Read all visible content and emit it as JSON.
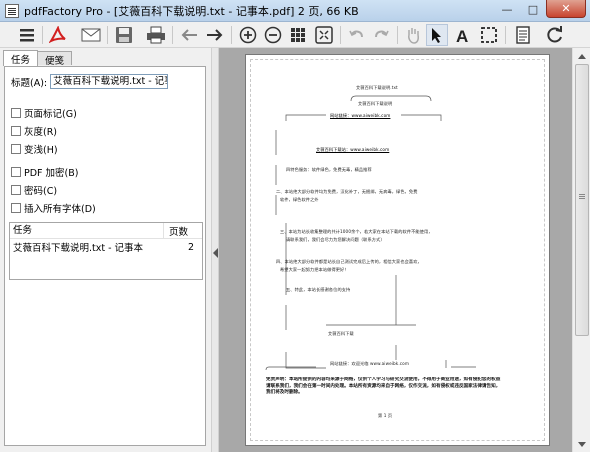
{
  "window": {
    "title": "pdfFactory Pro - [艾薇百科下载说明.txt - 记事本.pdf] 2 页, 66 KB",
    "minimize": "—",
    "maximize": "□",
    "close": "✕"
  },
  "toolbar": {
    "icons": [
      "menu-icon",
      "pdf-icon",
      "email-icon",
      "save-icon",
      "print-icon",
      "back-arrow-icon",
      "forward-arrow-icon",
      "zoom-in-icon",
      "zoom-out-icon",
      "grid-icon",
      "fit-page-icon",
      "undo-icon",
      "redo-icon",
      "hand-icon",
      "pointer-icon",
      "text-icon",
      "select-rect-icon",
      "document-icon",
      "refresh-icon"
    ]
  },
  "tabs": [
    {
      "label": "任务",
      "active": true
    },
    {
      "label": "便笺",
      "active": false
    }
  ],
  "task_panel": {
    "title_label": "标题(A):",
    "title_value": "艾薇百科下载说明.txt - 记事本",
    "checkboxes": [
      {
        "label": "页面标记(G)",
        "checked": false
      },
      {
        "label": "灰度(R)",
        "checked": false
      },
      {
        "label": "变浅(H)",
        "checked": false
      },
      {
        "label": "PDF 加密(B)",
        "checked": false
      },
      {
        "label": "密码(C)",
        "checked": false
      },
      {
        "label": "插入所有字体(D)",
        "checked": false
      }
    ],
    "table": {
      "col_task": "任务",
      "col_pages": "页数",
      "rows": [
        {
          "task": "艾薇百科下载说明.txt - 记事本",
          "pages": "2"
        }
      ]
    }
  },
  "preview": {
    "lines": [
      "艾薇百科下载说明.txt",
      "艾薇百科下载说明",
      "网站链接：www.aiweibk.com",
      "艾薇百科下载站：www.aiweibk.com",
      "四特色服务：软件绿色，免费无毒，精品推荐",
      "二、本站绝大部分软件均为免费，汉化补丁，无捆绑，无病毒，绿色，免费",
      "软件，绿色软件之外",
      "三、本站为站长收集整理的共计1000余个，若大家在本站下载的软件不能使用，",
      "请联系我们，我们会尽力为您解决问题（联系方式）",
      "四、本站绝大部分软件都是站长自己测试完成后上传的，相信大家也会喜欢，",
      "希望大家一起努力把本站做得更好！",
      "五、特此，本站长感谢各位的支持",
      "艾薇百科下载",
      "网站链接：欢迎光临 www.aiweibk.com"
    ],
    "disclaimer": "免责声明：本站所提供的内容均来源于网络，仅供个人学习与研究交流使用，不得用于商业用途，如有侵犯您的权益请联系我们，我们会在第一时间内处理。本站所有资源均来自于网络，仅作交流，如有侵权或违反国家法律请告知，我们将及时删除。",
    "footer": "第 1 页"
  }
}
